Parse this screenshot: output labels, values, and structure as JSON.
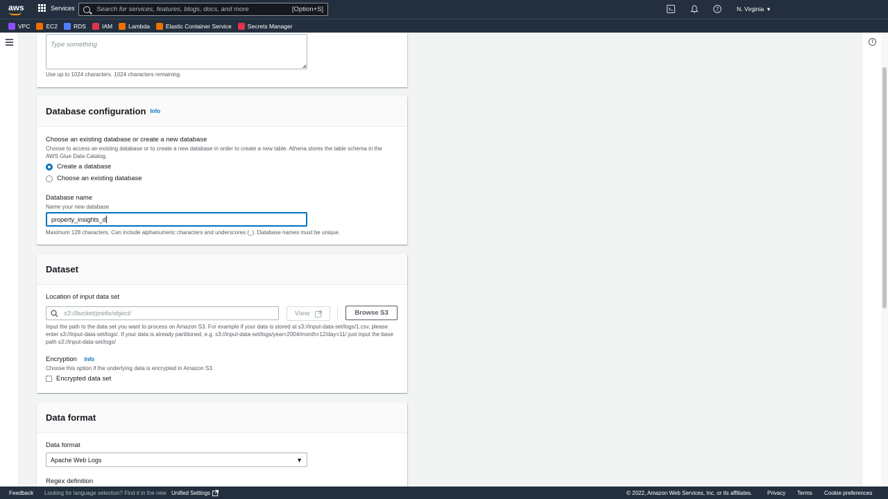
{
  "topnav": {
    "logo_text": "aws",
    "services_label": "Services",
    "search_placeholder": "Search for services, features, blogs, docs, and more",
    "search_shortcut": "[Option+S]",
    "region": "N. Virginia"
  },
  "favorites": [
    {
      "label": "VPC",
      "color": "#8c4fff"
    },
    {
      "label": "EC2",
      "color": "#ed7100"
    },
    {
      "label": "RDS",
      "color": "#527fff"
    },
    {
      "label": "IAM",
      "color": "#dd344c"
    },
    {
      "label": "Lambda",
      "color": "#ed7100"
    },
    {
      "label": "Elastic Container Service",
      "color": "#ed7100"
    },
    {
      "label": "Secrets Manager",
      "color": "#dd344c"
    }
  ],
  "description_panel": {
    "textarea_placeholder": "Type something",
    "hint": "Use up to 1024 characters. 1024 characters remaining."
  },
  "database_config": {
    "title": "Database configuration",
    "info": "Info",
    "choose_label": "Choose an existing database or create a new database",
    "choose_desc": "Choose to access an existing database or to create a new database in order to create a new table. Athena stores the table schema in the AWS Glue Data Catalog.",
    "option_create": "Create a database",
    "option_existing": "Choose an existing database",
    "db_name_label": "Database name",
    "db_name_desc": "Name your new database",
    "db_name_value": "property_insights_d",
    "db_name_hint": "Maximum 128 characters. Can include alphanumeric characters and underscores (_). Database names must be unique."
  },
  "dataset": {
    "title": "Dataset",
    "location_label": "Location of input data set",
    "location_placeholder": "s3://bucket/prefix/object/",
    "view_label": "View",
    "browse_label": "Browse S3",
    "location_desc": "Input the path to the data set you want to process on Amazon S3. For example if your data is stored at s3://input-data-set/logs/1.csv, please enter s3://input-data-set/logs/. If your data is already partitioned, e.g. s3://input-data-set/logs/year=2004/month=12/day=11/ just input the base path s3://input-data-set/logs/",
    "encryption_label": "Encryption",
    "encryption_info": "Info",
    "encryption_desc": "Choose this option if the underlying data is encrypted in Amazon S3.",
    "encrypted_checkbox": "Encrypted data set"
  },
  "data_format": {
    "title": "Data format",
    "format_label": "Data format",
    "format_value": "Apache Web Logs",
    "regex_label": "Regex definition"
  },
  "footer": {
    "feedback": "Feedback",
    "language_msg": "Looking for language selection? Find it in the new",
    "unified_settings": "Unified Settings",
    "copyright": "© 2022, Amazon Web Services, Inc. or its affiliates.",
    "privacy": "Privacy",
    "terms": "Terms",
    "cookies": "Cookie preferences"
  }
}
